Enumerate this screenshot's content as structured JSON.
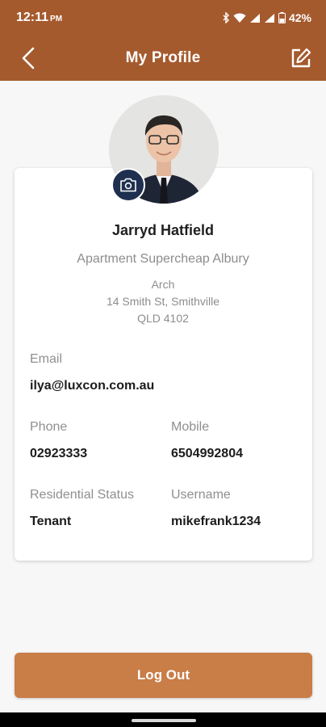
{
  "status_bar": {
    "time": "12:11",
    "ampm": "PM",
    "battery": "42%"
  },
  "app_bar": {
    "title": "My Profile",
    "icons": {
      "back": "chevron-left-icon",
      "edit": "edit-icon"
    }
  },
  "profile": {
    "name": "Jarryd Hatfield",
    "complex": "Apartment Supercheap Albury",
    "address_line1": "Arch",
    "address_line2": "14 Smith St, Smithville",
    "address_line3": "QLD 4102"
  },
  "fields": {
    "email_label": "Email",
    "email_value": "ilya@luxcon.com.au",
    "phone_label": "Phone",
    "phone_value": "02923333",
    "mobile_label": "Mobile",
    "mobile_value": "6504992804",
    "status_label": "Residential Status",
    "status_value": "Tenant",
    "username_label": "Username",
    "username_value": "mikefrank1234"
  },
  "actions": {
    "logout_label": "Log Out"
  },
  "colors": {
    "header": "#a55a2e",
    "button": "#c97d47",
    "camera_badge": "#1f2f4f"
  }
}
